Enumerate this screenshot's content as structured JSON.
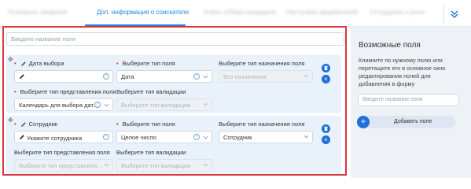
{
  "tabs": {
    "items": [
      {
        "label": "Основные сведения"
      },
      {
        "label": "Доп. информация о соискателе"
      },
      {
        "label": "Этапы отбора кандидата"
      },
      {
        "label": "Настройки уведомлений"
      },
      {
        "label": "Сотрудники и роли"
      }
    ]
  },
  "main": {
    "search_placeholder": "Введите название поля",
    "cards": [
      {
        "title_label": "Дата выбора",
        "title_value": "",
        "field_type_label": "Выберите тип поля",
        "field_type_value": "Дата",
        "purpose_label": "Выберите тип назначения поля",
        "purpose_value": "Без назначения",
        "view_label": "Выберите тип представления поля",
        "view_value": "Календарь для выбора дат...",
        "validation_label": "Выберите тип валидации",
        "validation_value": "Выберите тип валидации"
      },
      {
        "title_label": "Сотрудник",
        "title_value": "Укажите сотрудника",
        "field_type_label": "Выберите тип поля",
        "field_type_value": "Целое число",
        "purpose_label": "Выберите тип назначения поля",
        "purpose_value": "Сотрудник",
        "view_label": "Выберите тип представления поля",
        "view_value": "Выберите тип представлени...",
        "validation_label": "Выберите тип валидации",
        "validation_value": "Выберите тип валидации"
      }
    ]
  },
  "sidebar": {
    "title": "Возможные поля",
    "description": "Кликните по нужному полю или перетащите его в основное окно редактирования полей для добавления в форму",
    "search_placeholder": "Введите название поля",
    "add_button_label": "Добавить поле"
  },
  "colors": {
    "accent": "#1e88e5",
    "card_bg": "#e9f1fb",
    "highlight": "#d9363e",
    "required": "#e53935"
  }
}
